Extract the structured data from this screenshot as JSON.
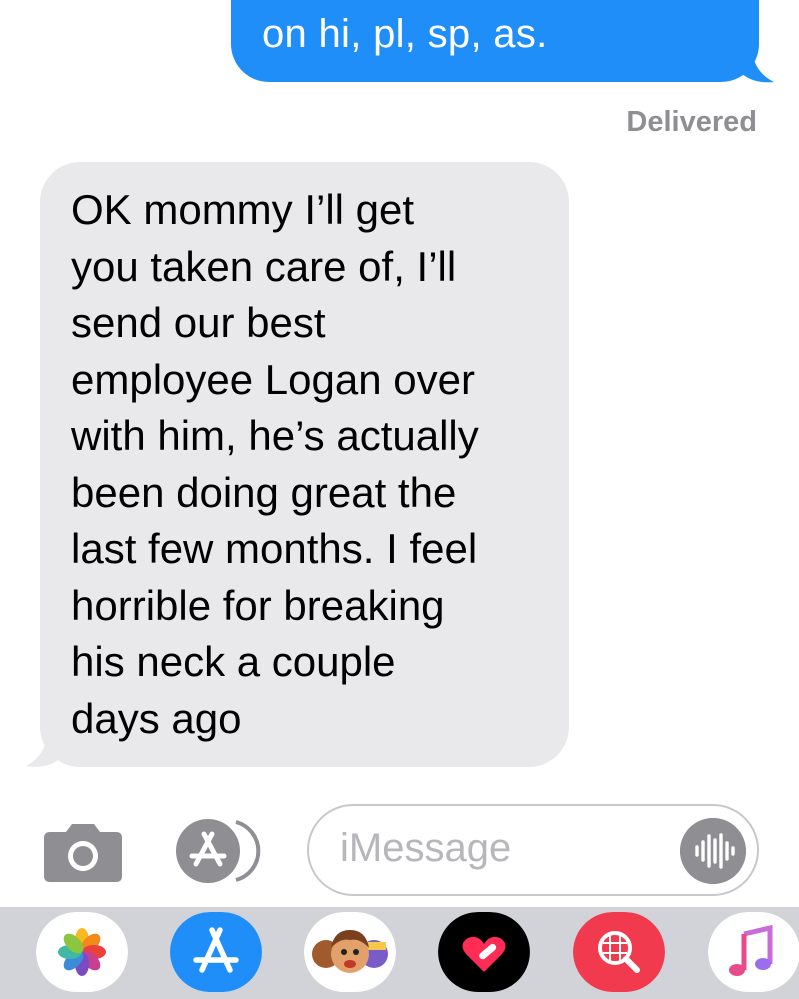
{
  "conversation": {
    "sent_message": {
      "text": "on hi, pl, sp, as."
    },
    "delivery_status": "Delivered",
    "received_message": {
      "lines": [
        "OK mommy I’ll get",
        "you taken care of, I’ll",
        "send our best",
        "employee Logan over",
        "with him, he’s actually",
        "been doing great the",
        "last few months. I feel",
        "horrible for breaking",
        "his neck a couple",
        "days ago"
      ]
    }
  },
  "composer": {
    "placeholder": "iMessage",
    "camera_icon": "camera-icon",
    "apps_icon": "app-store-icon",
    "audio_icon": "audio-waveform-icon"
  },
  "app_drawer": {
    "apps": [
      {
        "name": "photos-icon"
      },
      {
        "name": "app-store-icon"
      },
      {
        "name": "memoji-icon"
      },
      {
        "name": "digital-touch-icon"
      },
      {
        "name": "images-search-icon"
      },
      {
        "name": "music-icon"
      }
    ]
  },
  "colors": {
    "sent_bubble": "#1f8ef8",
    "received_bubble": "#e9e9eb",
    "delivered_text": "#8e8e93",
    "drawer_bg": "#d1d3d9"
  }
}
